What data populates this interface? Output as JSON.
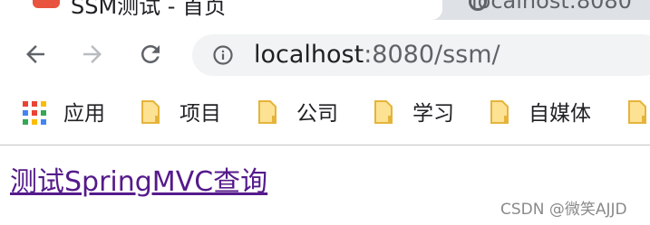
{
  "tabs": {
    "active_title": "SSM测试 - 首页",
    "second_title": "localhost:8080"
  },
  "toolbar": {
    "back_icon": "arrow-left-icon",
    "forward_icon": "arrow-right-icon",
    "reload_icon": "reload-icon",
    "info_icon": "info-icon",
    "url_host": "localhost",
    "url_rest": ":8080/ssm/"
  },
  "bookmarks": {
    "apps_label": "应用",
    "items": [
      {
        "label": "项目",
        "icon": "folder-icon"
      },
      {
        "label": "公司",
        "icon": "folder-icon"
      },
      {
        "label": "学习",
        "icon": "folder-icon"
      },
      {
        "label": "自媒体",
        "icon": "folder-icon"
      }
    ]
  },
  "page": {
    "link_text": "测试SpringMVC查询",
    "watermark": "CSDN @微笑AJJD"
  },
  "colors": {
    "visited_link": "#551a8b",
    "folder_fill": "#fde293",
    "folder_stroke": "#e6b33a",
    "tab_strip": "#dee1e6",
    "omnibox": "#f1f3f4"
  }
}
